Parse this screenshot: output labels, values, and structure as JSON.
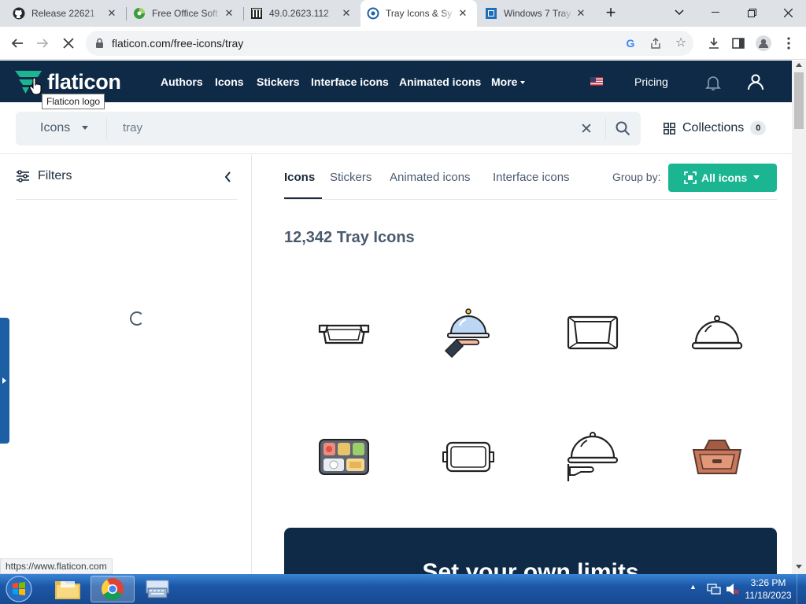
{
  "browser": {
    "tabs": [
      {
        "title": "Release 22621",
        "favicon": "github-icon"
      },
      {
        "title": "Free Office Soft",
        "favicon": "office-icon"
      },
      {
        "title": "49.0.2623.112",
        "favicon": "archive-icon"
      },
      {
        "title": "Tray Icons & Sy",
        "favicon": "flaticon-icon"
      },
      {
        "title": "Windows 7 Tray",
        "favicon": "windows-icon"
      }
    ],
    "active_tab_index": 3,
    "url": "flaticon.com/free-icons/tray",
    "status_url": "https://www.flaticon.com"
  },
  "header": {
    "logo_text": "flaticon",
    "tooltip": "Flaticon logo",
    "nav": [
      "Authors",
      "Icons",
      "Stickers",
      "Interface icons",
      "Animated icons",
      "More"
    ],
    "pricing": "Pricing"
  },
  "search": {
    "type": "Icons",
    "query": "tray",
    "collections_label": "Collections",
    "collections_count": "0"
  },
  "sidebar": {
    "filters_label": "Filters"
  },
  "content": {
    "tabs": [
      "Icons",
      "Stickers",
      "Animated icons",
      "Interface icons"
    ],
    "active_tab": "Icons",
    "group_by_label": "Group by:",
    "group_by_value": "All icons",
    "result_title": "12,342 Tray Icons",
    "icons": [
      "baking-tray-icon",
      "serving-tray-hand-icon",
      "tray-icon",
      "cloche-icon",
      "bento-box-icon",
      "rectangular-tray-icon",
      "cloche-hand-icon",
      "wooden-tray-icon"
    ],
    "banner_text": "Set your own limits"
  },
  "taskbar": {
    "time": "3:26 PM",
    "date": "11/18/2023"
  },
  "colors": {
    "header_bg": "#0e2a47",
    "accent_green": "#1bb591",
    "side_tab_blue": "#1c5fa5"
  }
}
